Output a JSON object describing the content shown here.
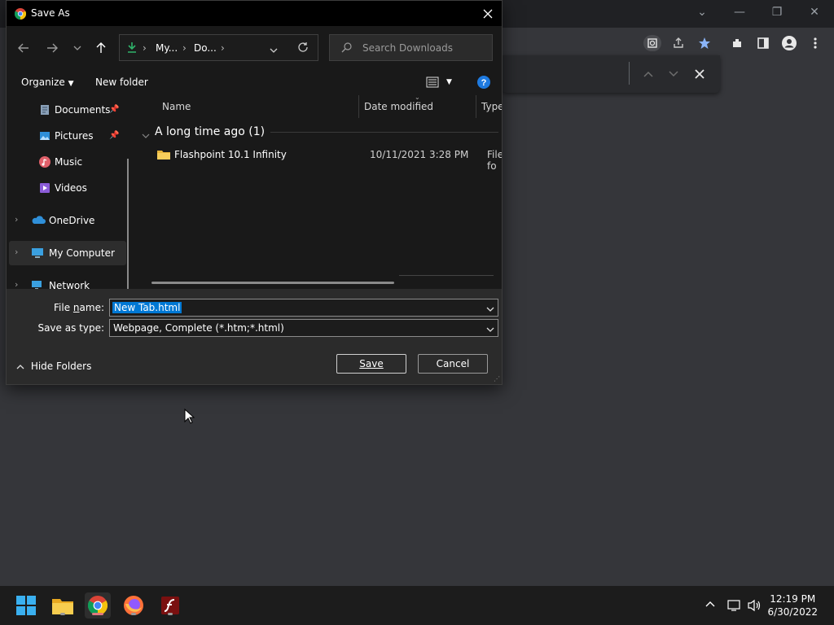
{
  "dialog": {
    "title": "Save As",
    "breadcrumb": [
      "My...",
      "Do..."
    ],
    "search_placeholder": "Search Downloads",
    "organize_label": "Organize",
    "new_folder_label": "New folder",
    "sidebar": [
      {
        "label": "Documents",
        "icon": "documents-icon",
        "pinned": true
      },
      {
        "label": "Pictures",
        "icon": "pictures-icon",
        "pinned": true
      },
      {
        "label": "Music",
        "icon": "music-icon",
        "pinned": false
      },
      {
        "label": "Videos",
        "icon": "videos-icon",
        "pinned": false
      },
      {
        "label": "OneDrive",
        "icon": "onedrive-icon",
        "expandable": true
      },
      {
        "label": "My Computer",
        "icon": "computer-icon",
        "expandable": true,
        "selected": true
      },
      {
        "label": "Network",
        "icon": "network-icon",
        "expandable": true
      }
    ],
    "columns": [
      "Name",
      "Date modified",
      "Type"
    ],
    "group_header": "A long time ago (1)",
    "files": [
      {
        "name": "Flashpoint 10.1 Infinity",
        "date": "10/11/2021 3:28 PM",
        "type": "File fo"
      }
    ],
    "file_name_label": "File name:",
    "file_name_value": "New Tab.html",
    "save_type_label": "Save as type:",
    "save_type_value": "Webpage, Complete (*.htm;*.html)",
    "hide_folders_label": "Hide Folders",
    "save_label": "Save",
    "cancel_label": "Cancel"
  },
  "taskbar": {
    "apps": [
      "start-icon",
      "file-explorer-icon",
      "chrome-icon",
      "firefox-icon",
      "flash-icon"
    ],
    "time": "12:19 PM",
    "date": "6/30/2022"
  },
  "colors": {
    "accent": "#0078d4",
    "dialog_bg": "#191919",
    "chrome_bg": "#35363a"
  }
}
